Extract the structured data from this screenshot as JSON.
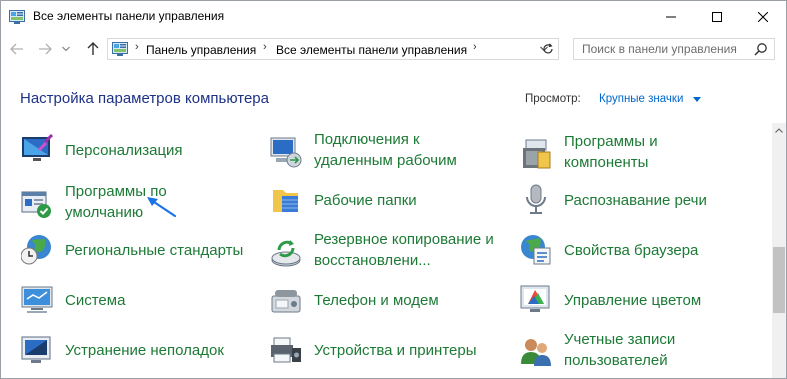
{
  "window": {
    "title": "Все элементы панели управления"
  },
  "navigation": {
    "breadcrumbs": [
      "Панель управления",
      "Все элементы панели управления"
    ],
    "search_placeholder": "Поиск в панели управления"
  },
  "header": {
    "title": "Настройка параметров компьютера",
    "view_label": "Просмотр:",
    "view_value": "Крупные значки"
  },
  "items": [
    {
      "label_lines": [
        "Персонализация"
      ],
      "icon": "personalization-icon"
    },
    {
      "label_lines": [
        "Подключения к",
        "удаленным рабочим"
      ],
      "icon": "remote-connections-icon"
    },
    {
      "label_lines": [
        "Программы и",
        "компоненты"
      ],
      "icon": "programs-features-icon"
    },
    {
      "label_lines": [
        "Программы по",
        "умолчанию"
      ],
      "icon": "default-programs-icon"
    },
    {
      "label_lines": [
        "Рабочие папки"
      ],
      "icon": "work-folders-icon"
    },
    {
      "label_lines": [
        "Распознавание речи"
      ],
      "icon": "speech-recognition-icon"
    },
    {
      "label_lines": [
        "Региональные стандарты"
      ],
      "icon": "region-icon"
    },
    {
      "label_lines": [
        "Резервное копирование и",
        "восстановлени..."
      ],
      "icon": "backup-restore-icon"
    },
    {
      "label_lines": [
        "Свойства браузера"
      ],
      "icon": "internet-options-icon"
    },
    {
      "label_lines": [
        "Система"
      ],
      "icon": "system-icon"
    },
    {
      "label_lines": [
        "Телефон и модем"
      ],
      "icon": "phone-modem-icon"
    },
    {
      "label_lines": [
        "Управление цветом"
      ],
      "icon": "color-management-icon"
    },
    {
      "label_lines": [
        "Устранение неполадок"
      ],
      "icon": "troubleshooting-icon"
    },
    {
      "label_lines": [
        "Устройства и принтеры"
      ],
      "icon": "devices-printers-icon"
    },
    {
      "label_lines": [
        "Учетные записи",
        "пользователей"
      ],
      "icon": "user-accounts-icon"
    }
  ],
  "colors": {
    "link_green": "#1d7a36",
    "title_blue": "#1e3287",
    "accent_blue": "#0066cc",
    "annotation_arrow": "#1a73e8"
  }
}
